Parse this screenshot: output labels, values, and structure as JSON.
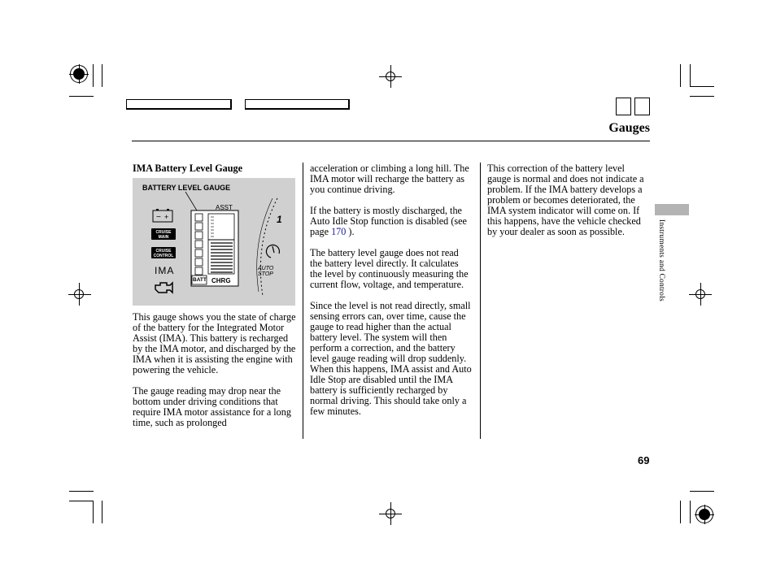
{
  "header": {
    "section_title": "Gauges",
    "side_tab_label": "Instruments and Controls",
    "page_number": "69"
  },
  "figure": {
    "title": "BATTERY LEVEL GAUGE",
    "labels": {
      "asst": "ASST",
      "chrg": "CHRG",
      "batt": "BATT",
      "auto_stop": "AUTO STOP",
      "cruise_main": "CRUISE MAIN",
      "cruise_control": "CRUISE CONTROL",
      "ima": "IMA",
      "gauge_number": "1"
    },
    "assist_bars_lit": 0,
    "charge_bars_lit": 1.0
  },
  "columns": [
    {
      "subhead": "IMA Battery Level Gauge",
      "paragraphs": [
        "This gauge shows you the state of charge of the battery for the Integrated Motor Assist (IMA). This battery is recharged by the IMA motor, and discharged by the IMA when it is assisting the engine with powering the vehicle.",
        "The gauge reading may drop near the bottom under driving conditions that require IMA motor assistance for a long time, such as prolonged"
      ]
    },
    {
      "paragraphs": [
        "acceleration or climbing a long hill. The IMA motor will recharge the battery as you continue driving.",
        "If the battery is mostly discharged, the Auto Idle Stop function is disabled (see page",
        "The battery level gauge does not read the battery level directly. It calculates the level by continuously measuring the current flow, voltage, and temperature.",
        "Since the level is not read directly, small sensing errors can, over time, cause the gauge to read higher than the actual battery level. The system will then perform a correction, and the battery level gauge reading will drop suddenly. When this happens, IMA assist and Auto Idle Stop are disabled until the IMA battery is sufficiently recharged by normal driving. This should take only a few minutes."
      ],
      "page_ref": "170",
      "page_ref_suffix": " )."
    },
    {
      "paragraphs": [
        "This correction of the battery level gauge is normal and does not indicate a problem. If the IMA battery develops a problem or becomes deteriorated, the IMA system indicator will come on. If this happens, have the vehicle checked by your dealer as soon as possible."
      ]
    }
  ],
  "colors": {
    "link": "#1a1aa8",
    "figure_bg": "#d0d0d0",
    "side_tab": "#b3b3b3"
  }
}
